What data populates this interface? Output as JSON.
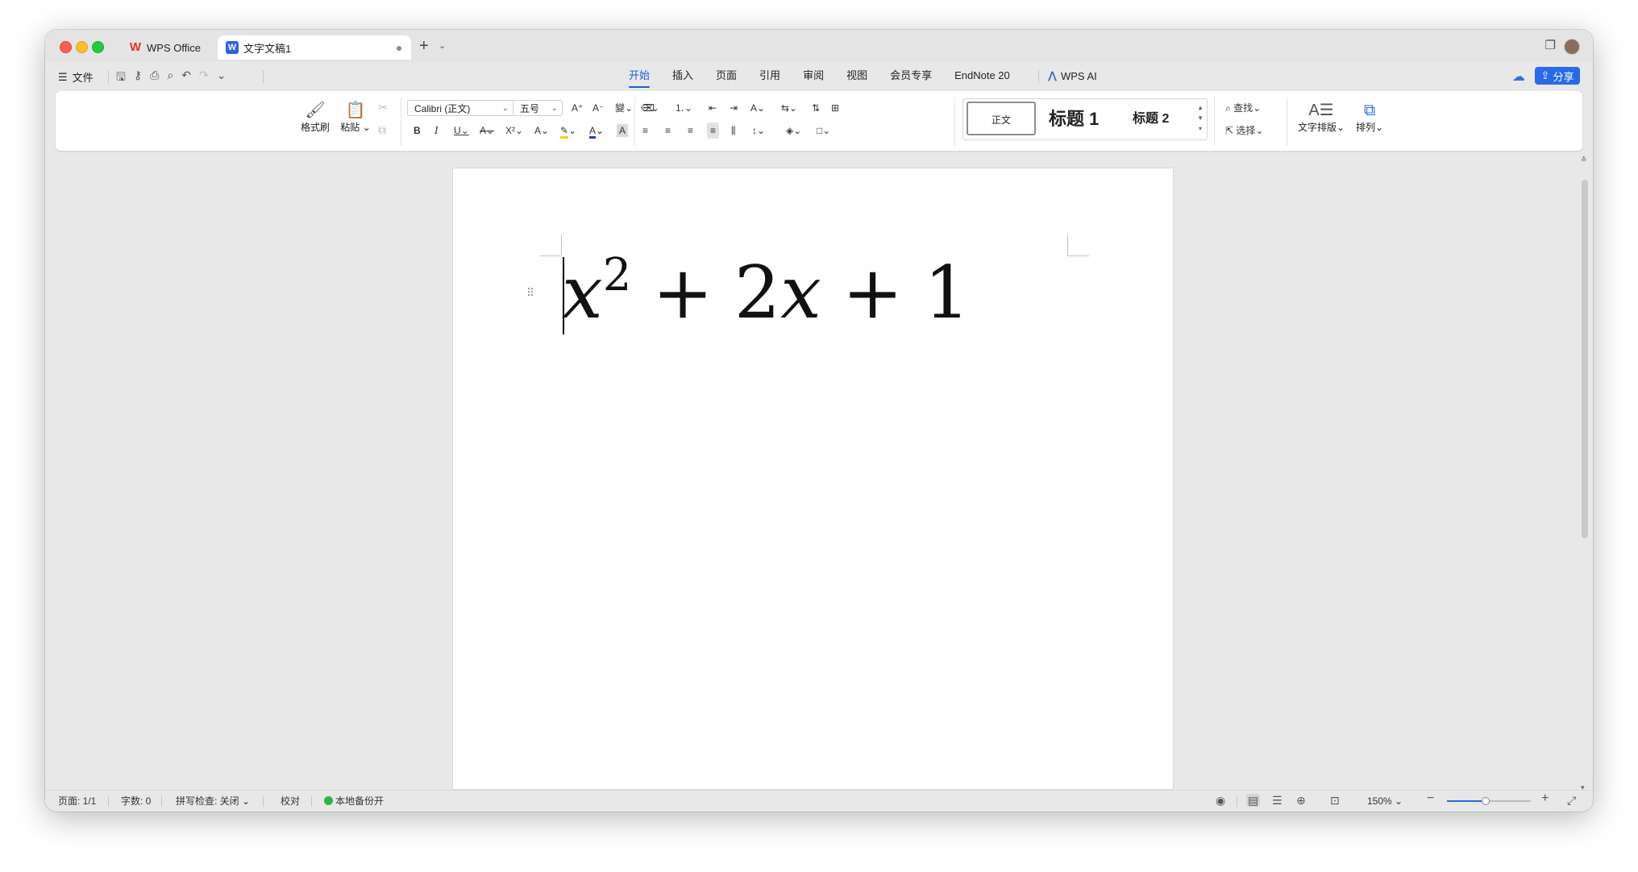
{
  "tabs": {
    "home_label": "WPS Office",
    "doc_label": "文字文稿1",
    "doc_icon_letter": "W"
  },
  "menubar": {
    "file_label": "文件",
    "items": [
      "开始",
      "插入",
      "页面",
      "引用",
      "审阅",
      "视图",
      "会员专享",
      "EndNote 20"
    ],
    "active_index": 0,
    "wps_ai_label": "WPS AI",
    "share_label": "分享"
  },
  "ribbon": {
    "format_painter_label": "格式刷",
    "paste_label": "粘贴",
    "font_name": "Calibri (正文)",
    "font_size": "五号",
    "styles": {
      "normal": "正文",
      "heading1": "标题 1",
      "heading2": "标题 2"
    },
    "find_label": "查找",
    "select_label": "选择",
    "text_layout_label": "文字排版",
    "arrange_label": "排列"
  },
  "document": {
    "equation": {
      "base": "x",
      "exponent": "2",
      "plus1": "+",
      "coef": "2",
      "var2": "x",
      "plus2": "+",
      "const": "1"
    }
  },
  "statusbar": {
    "page": "页面: 1/1",
    "word_count": "字数: 0",
    "spellcheck": "拼写检查: 关闭",
    "proofread": "校对",
    "backup": "本地备份开",
    "zoom": "150%",
    "zoom_fraction": 0.45
  },
  "colors": {
    "accent": "#2a6ae9",
    "active_tab": "#1a5fd6",
    "wps_red": "#e3322b",
    "backup_green": "#2fb344"
  }
}
